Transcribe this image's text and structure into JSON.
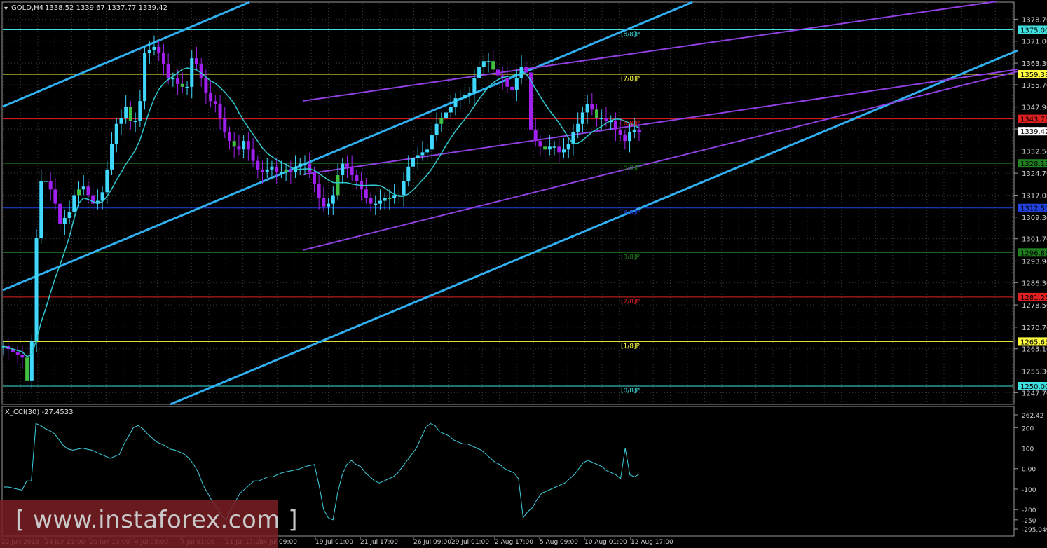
{
  "header": {
    "symbol": "GOLD,H4",
    "ohlc": "1338.52 1339.67 1337.77 1339.42"
  },
  "indicator": {
    "label": "X_CCI(30) -27.4533"
  },
  "watermark": "[ www.instaforex.com ]",
  "colors": {
    "background": "#000000",
    "bull_candle": "#40d8ff",
    "bear_candle": "#a020f0",
    "green_candle": "#40c040",
    "channel": "#30b0f0",
    "purple_channel": "#9040e0",
    "ma": "#30c8d0",
    "cci": "#40d0e0"
  },
  "chart_data": {
    "type": "candlestick",
    "price_axis": {
      "range": [
        1244.1,
        1382.0
      ],
      "ticks": [
        "1378.70",
        "1371.00",
        "1363.30",
        "1355.70",
        "1347.90",
        "1340.20",
        "1332.50",
        "1324.70",
        "1317.00",
        "1309.30",
        "1301.70",
        "1293.90",
        "1286.30",
        "1278.50",
        "1270.70",
        "1263.10",
        "1255.30",
        "1247.70"
      ],
      "current": "1339.42"
    },
    "x_axis": {
      "ticks": [
        "22 Jun 2016",
        "24 Jun 21:00",
        "29 Jun 13:00",
        "4 Jul 05:00",
        "7 Jul 01:00",
        "11 Jul 17:00",
        "14 Jul 09:00",
        "19 Jul 01:00",
        "21 Jul 17:00",
        "26 Jul 09:00",
        "29 Jul 01:00",
        "2 Aug 17:00",
        "5 Aug 09:00",
        "10 Aug 01:00",
        "12 Aug 17:00"
      ]
    },
    "murrey_levels": [
      {
        "price": 1375.0,
        "label": "1375.00",
        "tag": "[8/8]P",
        "color": "#40e0e0"
      },
      {
        "price": 1359.38,
        "label": "1359.38",
        "tag": "[7/8]P",
        "color": "#ffff40"
      },
      {
        "price": 1343.75,
        "label": "1343.75",
        "tag": "[6/8]P",
        "color": "#e02020"
      },
      {
        "price": 1328.13,
        "label": "1328.13",
        "tag": "[5/8]P",
        "color": "#208020"
      },
      {
        "price": 1312.5,
        "label": "1312.50",
        "tag": "[4/8]P",
        "color": "#2040e0"
      },
      {
        "price": 1296.88,
        "label": "1296.88",
        "tag": "[3/8]P",
        "color": "#208020"
      },
      {
        "price": 1281.25,
        "label": "1281.25",
        "tag": "[2/8]P",
        "color": "#e02020"
      },
      {
        "price": 1265.63,
        "label": "1265.63",
        "tag": "[1/8]P",
        "color": "#ffff40"
      },
      {
        "price": 1250.0,
        "label": "1250.00",
        "tag": "[0/8]P",
        "color": "#40e0e0"
      }
    ],
    "close_series": [
      1264,
      1263,
      1262,
      1261,
      1260,
      1252,
      1266,
      1302,
      1322,
      1322,
      1319,
      1314,
      1307,
      1309,
      1311,
      1317,
      1319,
      1320,
      1317,
      1314,
      1315,
      1318,
      1326,
      1335,
      1342,
      1344,
      1348,
      1343,
      1343,
      1350,
      1367,
      1368,
      1369,
      1367,
      1363,
      1358,
      1358,
      1356,
      1355,
      1355,
      1365,
      1363,
      1358,
      1353,
      1350,
      1349,
      1344,
      1339,
      1336,
      1334,
      1333,
      1336,
      1333,
      1329,
      1326,
      1325,
      1326,
      1327,
      1325,
      1325,
      1326,
      1325,
      1327,
      1328,
      1328,
      1325,
      1321,
      1316,
      1313,
      1314,
      1317,
      1324,
      1328,
      1327,
      1324,
      1322,
      1319,
      1316,
      1314,
      1314,
      1315,
      1316,
      1316,
      1317,
      1317,
      1322,
      1327,
      1330,
      1331,
      1332,
      1333,
      1338,
      1342,
      1344,
      1346,
      1348,
      1351,
      1351,
      1352,
      1353,
      1358,
      1362,
      1364,
      1364,
      1361,
      1359,
      1358,
      1355,
      1354,
      1358,
      1362,
      1360,
      1340,
      1336,
      1334,
      1333,
      1334,
      1334,
      1332,
      1333,
      1335,
      1339,
      1342,
      1346,
      1349,
      1347,
      1344,
      1344,
      1343,
      1343,
      1340,
      1338,
      1336,
      1339,
      1340,
      1339
    ],
    "cci_axis": {
      "ticks": [
        "262.42",
        "200",
        "100",
        "0.00",
        "-100",
        "-200",
        "-250",
        "-295.049"
      ]
    },
    "cci_series": [
      -90,
      -90,
      -95,
      -100,
      -105,
      -60,
      -60,
      220,
      210,
      195,
      185,
      170,
      140,
      110,
      95,
      90,
      95,
      100,
      95,
      90,
      80,
      70,
      60,
      50,
      60,
      70,
      120,
      160,
      200,
      210,
      195,
      170,
      150,
      130,
      120,
      110,
      95,
      90,
      80,
      70,
      50,
      20,
      -20,
      -80,
      -120,
      -160,
      -190,
      -230,
      -250,
      -200,
      -160,
      -120,
      -100,
      -80,
      -60,
      -60,
      -50,
      -40,
      -40,
      -30,
      -20,
      -15,
      -10,
      -5,
      0,
      10,
      15,
      20,
      -80,
      -200,
      -240,
      -250,
      -120,
      -30,
      20,
      40,
      20,
      10,
      -20,
      -40,
      -60,
      -70,
      -60,
      -50,
      -40,
      -20,
      10,
      40,
      70,
      100,
      150,
      200,
      220,
      210,
      180,
      170,
      160,
      140,
      130,
      120,
      120,
      110,
      100,
      90,
      70,
      50,
      30,
      20,
      0,
      -10,
      -20,
      -50,
      -240,
      -210,
      -190,
      -150,
      -120,
      -110,
      -100,
      -90,
      -80,
      -70,
      -50,
      -30,
      0,
      30,
      40,
      30,
      20,
      10,
      -10,
      -20,
      -30,
      -50,
      100,
      -30,
      -40,
      -27
    ]
  }
}
